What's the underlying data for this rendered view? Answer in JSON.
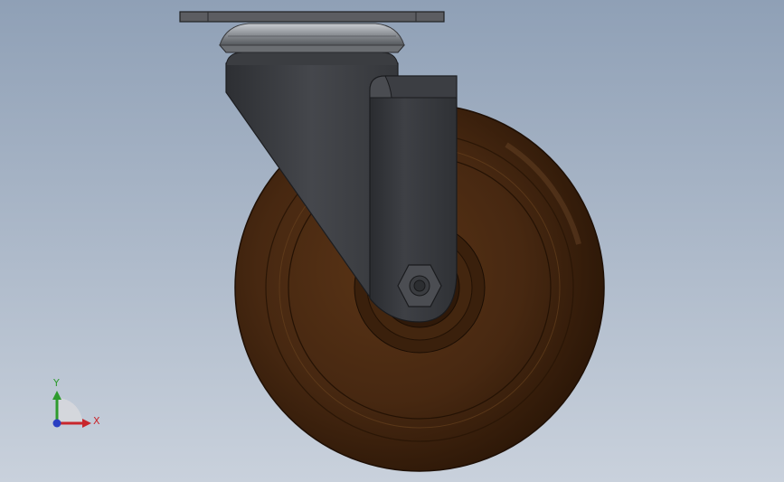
{
  "viewport": {
    "background_top": "#8fa0b6",
    "background_bottom": "#c9d1dc"
  },
  "model": {
    "parts": [
      "top-mounting-plate",
      "swivel-raceway",
      "fork-housing",
      "fork-leg",
      "wheel",
      "wheel-hub",
      "axle-nut"
    ],
    "colors": {
      "plate": "#5c5d61",
      "housing": "#3a3c40",
      "fork_leg": "#34363a",
      "wheel": "#4a2a12",
      "wheel_dark": "#2e1808",
      "hub": "#3d220d"
    }
  },
  "triad": {
    "y_label": "Y",
    "x_label": "X",
    "y_color": "#2e9b2e",
    "x_color": "#c8262c",
    "z_color": "#2a3fc2"
  }
}
